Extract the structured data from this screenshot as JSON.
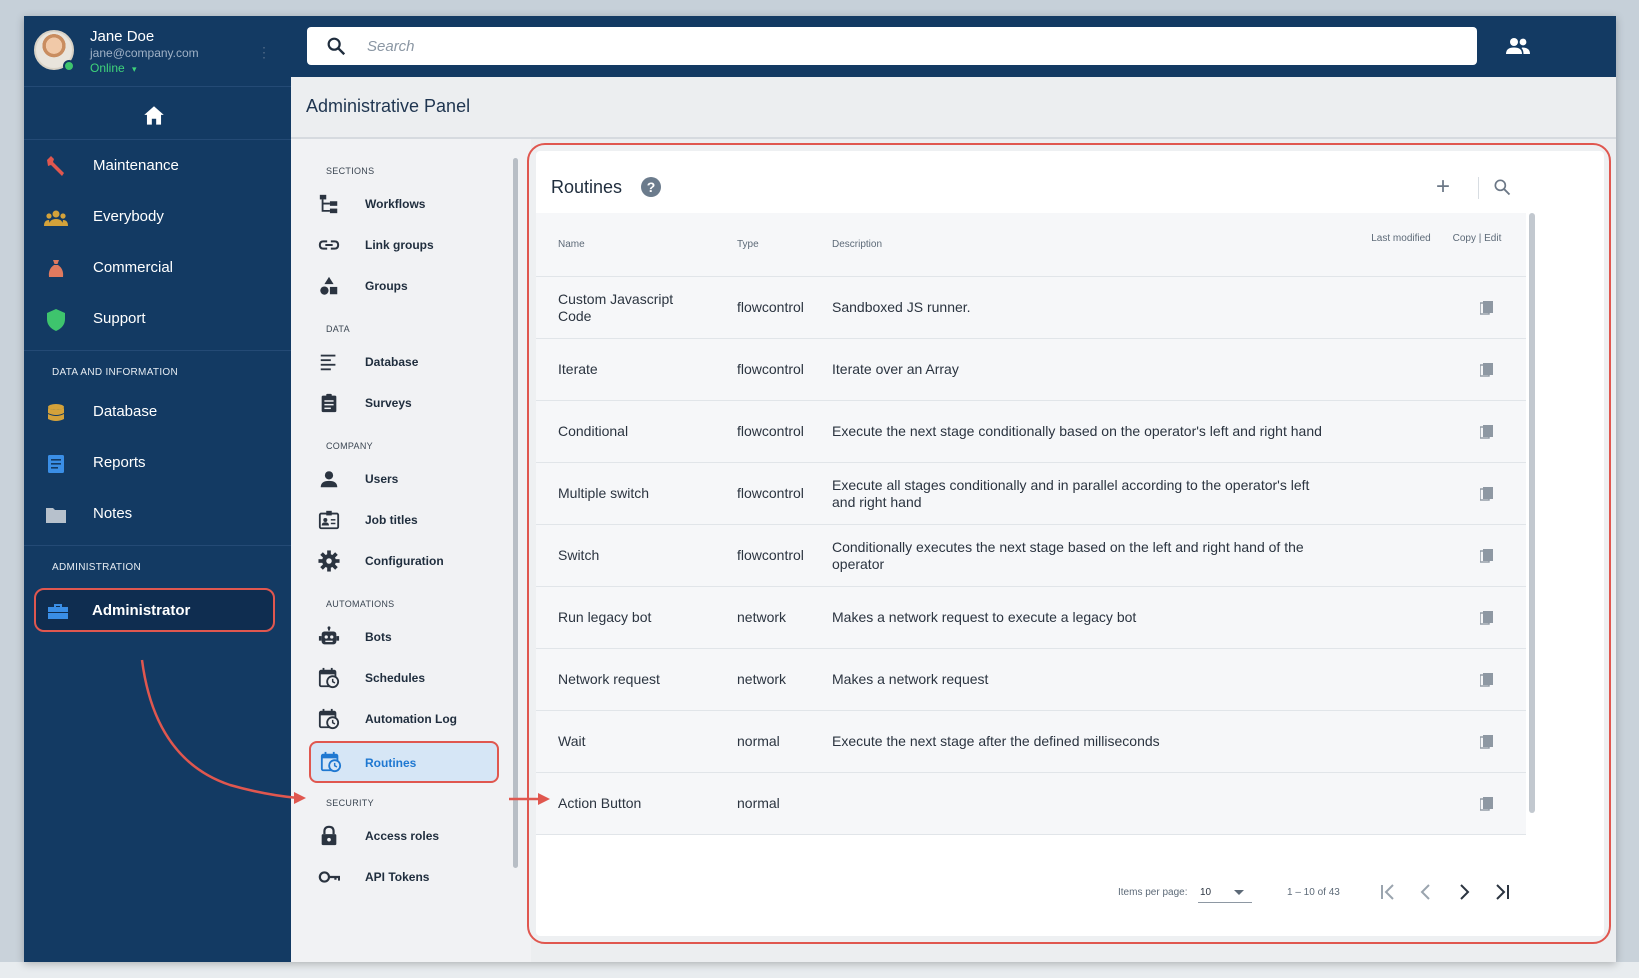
{
  "user": {
    "name": "Jane Doe",
    "email": "jane@company.com",
    "status": "Online",
    "status_arrow": "▾"
  },
  "sidebar": {
    "home_icon": "home-icon",
    "items": [
      {
        "label": "Maintenance",
        "icon": "wrench-icon",
        "color": "#e0574f"
      },
      {
        "label": "Everybody",
        "icon": "group-icon",
        "color": "#d4a23a"
      },
      {
        "label": "Commercial",
        "icon": "money-bag-icon",
        "color": "#e07a5f"
      },
      {
        "label": "Support",
        "icon": "shield-icon",
        "color": "#3ec46d"
      }
    ],
    "section_data": "DATA AND INFORMATION",
    "data_items": [
      {
        "label": "Database",
        "icon": "database-icon",
        "color": "#d4a23a"
      },
      {
        "label": "Reports",
        "icon": "report-icon",
        "color": "#3a8ee6"
      },
      {
        "label": "Notes",
        "icon": "folder-icon",
        "color": "#b7c1cc"
      }
    ],
    "section_admin": "ADMINISTRATION",
    "admin_item": {
      "label": "Administrator",
      "icon": "toolbox-icon",
      "color": "#3a8ee6"
    }
  },
  "search": {
    "placeholder": "Search"
  },
  "panel": {
    "title": "Administrative Panel"
  },
  "submenu": {
    "sections": [
      {
        "label": "SECTIONS",
        "items": [
          {
            "label": "Workflows",
            "icon": "workflow-icon"
          },
          {
            "label": "Link groups",
            "icon": "link-icon"
          },
          {
            "label": "Groups",
            "icon": "shapes-icon"
          }
        ]
      },
      {
        "label": "DATA",
        "items": [
          {
            "label": "Database",
            "icon": "list-icon"
          },
          {
            "label": "Surveys",
            "icon": "clipboard-icon"
          }
        ]
      },
      {
        "label": "COMPANY",
        "items": [
          {
            "label": "Users",
            "icon": "person-icon"
          },
          {
            "label": "Job titles",
            "icon": "badge-icon"
          },
          {
            "label": "Configuration",
            "icon": "gear-icon"
          }
        ]
      },
      {
        "label": "AUTOMATIONS",
        "items": [
          {
            "label": "Bots",
            "icon": "robot-icon"
          },
          {
            "label": "Schedules",
            "icon": "calendar-clock-icon"
          },
          {
            "label": "Automation Log",
            "icon": "calendar-clock-icon"
          },
          {
            "label": "Routines",
            "icon": "calendar-clock-icon",
            "active": true
          }
        ]
      },
      {
        "label": "SECURITY",
        "items": [
          {
            "label": "Access roles",
            "icon": "lock-icon"
          },
          {
            "label": "API Tokens",
            "icon": "key-icon"
          }
        ]
      }
    ]
  },
  "routines": {
    "title": "Routines",
    "help": "?",
    "add": "+",
    "columns": {
      "name": "Name",
      "type": "Type",
      "description": "Description",
      "last_modified": "Last modified",
      "copy_edit": "Copy | Edit"
    },
    "rows": [
      {
        "name": "Custom Javascript Code",
        "type": "flowcontrol",
        "description": "Sandboxed JS runner."
      },
      {
        "name": "Iterate",
        "type": "flowcontrol",
        "description": "Iterate over an Array"
      },
      {
        "name": "Conditional",
        "type": "flowcontrol",
        "description": "Execute the next stage conditionally based on the operator's left and right hand"
      },
      {
        "name": "Multiple switch",
        "type": "flowcontrol",
        "description": "Execute all stages conditionally and in parallel according to the operator's left and right hand"
      },
      {
        "name": "Switch",
        "type": "flowcontrol",
        "description": "Conditionally executes the next stage based on the left and right hand of the operator"
      },
      {
        "name": "Run legacy bot",
        "type": "network",
        "description": "Makes a network request to execute a legacy bot"
      },
      {
        "name": "Network request",
        "type": "network",
        "description": "Makes a network request"
      },
      {
        "name": "Wait",
        "type": "normal",
        "description": "Execute the next stage after the defined milliseconds"
      },
      {
        "name": "Action Button",
        "type": "normal",
        "description": ""
      }
    ],
    "pager": {
      "items_per_page_label": "Items per page:",
      "items_per_page": "10",
      "range": "1 – 10 of 43"
    }
  },
  "colors": {
    "sidebar_bg": "#133a63",
    "accent_red": "#e0574f",
    "active_blue": "#1f78d1"
  }
}
